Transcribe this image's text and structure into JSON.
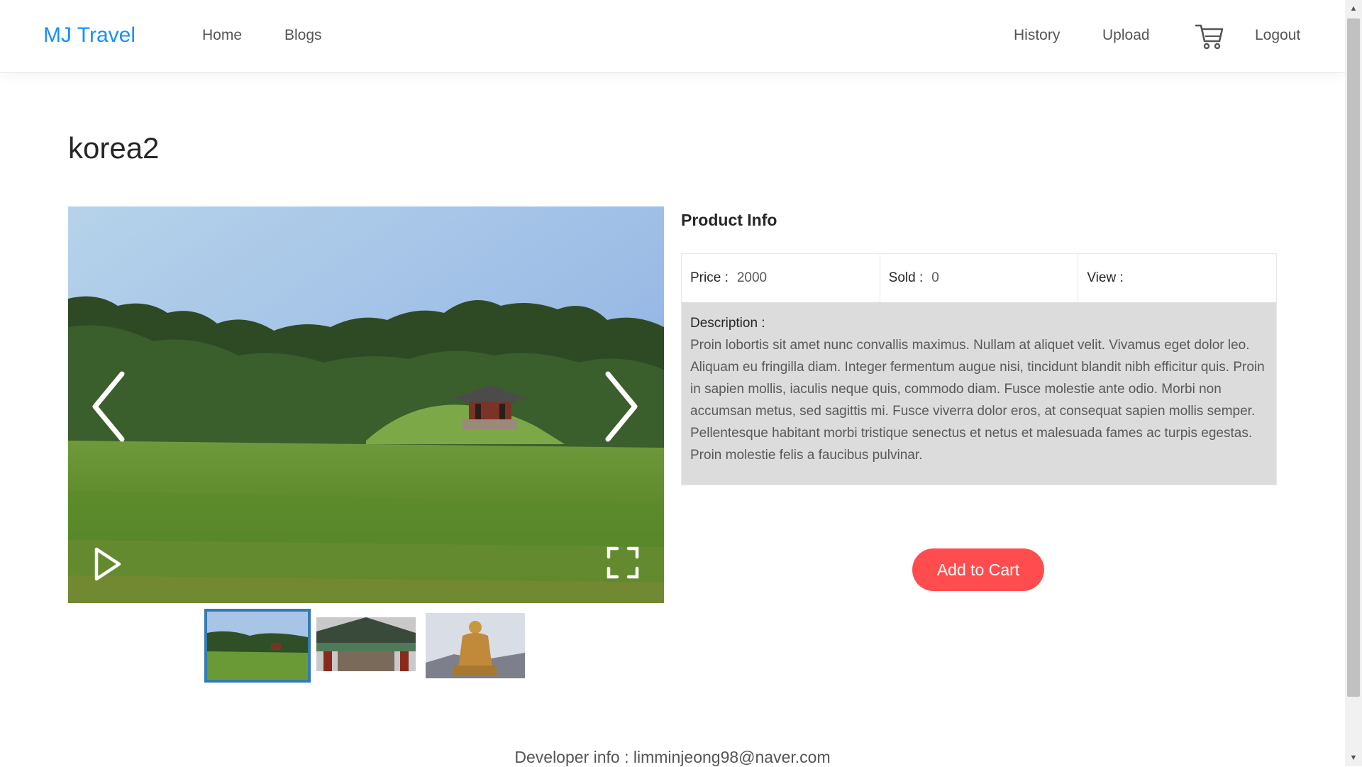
{
  "header": {
    "logo": "MJ Travel",
    "nav_left": [
      "Home",
      "Blogs"
    ],
    "nav_right": [
      "History",
      "Upload",
      "Logout"
    ],
    "cart_icon": "shopping-cart-icon"
  },
  "product": {
    "title": "korea2",
    "info_title": "Product Info",
    "price_label": "Price :",
    "price_value": "2000",
    "sold_label": "Sold :",
    "sold_value": "0",
    "view_label": "View :",
    "view_value": "",
    "description_label": "Description :",
    "description": "Proin lobortis sit amet nunc convallis maximus. Nullam at aliquet velit. Vivamus eget dolor leo. Aliquam eu fringilla diam. Integer fermentum augue nisi, tincidunt blandit nibh efficitur quis. Proin in sapien mollis, iaculis neque quis, commodo diam. Fusce molestie ante odio. Morbi non accumsan metus, sed sagittis mi. Fusce viverra dolor eros, at consequat sapien mollis semper. Pellentesque habitant morbi tristique senectus et netus et malesuada fames ac turpis egestas. Proin molestie felis a faucibus pulvinar.",
    "add_to_cart": "Add to Cart"
  },
  "gallery": {
    "controls": [
      "chevron-left-icon",
      "chevron-right-icon",
      "play-icon",
      "fullscreen-icon"
    ],
    "active_index": 0,
    "thumbnails": [
      "park-thumbnail",
      "temple-thumbnail",
      "statue-thumbnail"
    ]
  },
  "footer": {
    "text": "Developer info : limminjeong98@naver.com"
  },
  "colors": {
    "brand": "#1890ff",
    "cart_button": "#ff4d4f",
    "active_thumb_border": "#337ab7"
  }
}
